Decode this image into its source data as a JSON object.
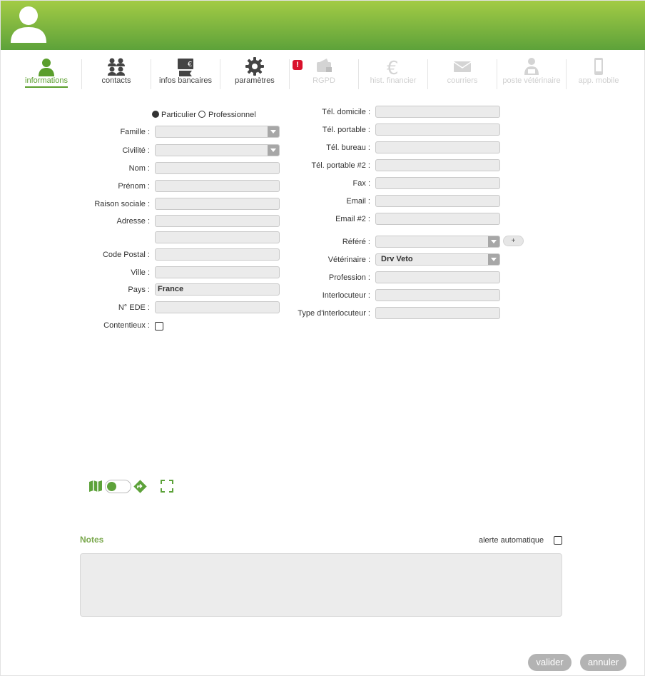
{
  "tabs": [
    {
      "label": "informations",
      "icon": "person-icon",
      "active": true
    },
    {
      "label": "contacts",
      "icon": "group-icon"
    },
    {
      "label": "infos bancaires",
      "icon": "bank-card-icon"
    },
    {
      "label": "paramètres",
      "icon": "gear-icon"
    },
    {
      "label": "RGPD",
      "icon": "wallet-lock-icon",
      "disabled": true
    },
    {
      "label": "hist. financier",
      "icon": "euro-icon",
      "disabled": true
    },
    {
      "label": "courriers",
      "icon": "envelope-icon",
      "disabled": true
    },
    {
      "label": "poste vétérinaire",
      "icon": "vet-person-icon",
      "disabled": true
    },
    {
      "label": "app. mobile",
      "icon": "mobile-icon",
      "disabled": true
    }
  ],
  "alert_badge": "!",
  "form_left": {
    "radio_particulier": "Particulier",
    "radio_professionnel": "Professionnel",
    "famille": {
      "label": "Famille :",
      "value": ""
    },
    "civilite": {
      "label": "Civilité :",
      "value": ""
    },
    "nom": {
      "label": "Nom :",
      "value": ""
    },
    "prenom": {
      "label": "Prénom :",
      "value": ""
    },
    "raison_sociale": {
      "label": "Raison sociale :",
      "value": ""
    },
    "adresse": {
      "label": "Adresse :",
      "value": "",
      "value2": ""
    },
    "code_postal": {
      "label": "Code Postal :",
      "value": ""
    },
    "ville": {
      "label": "Ville :",
      "value": ""
    },
    "pays": {
      "label": "Pays :",
      "value": "France"
    },
    "n_ede": {
      "label": "N° EDE :",
      "value": ""
    },
    "contentieux": {
      "label": "Contentieux :"
    }
  },
  "form_right": {
    "tel_domicile": {
      "label": "Tél. domicile :",
      "value": ""
    },
    "tel_portable": {
      "label": "Tél. portable :",
      "value": ""
    },
    "tel_bureau": {
      "label": "Tél. bureau :",
      "value": ""
    },
    "tel_portable2": {
      "label": "Tél. portable #2 :",
      "value": ""
    },
    "fax": {
      "label": "Fax :",
      "value": ""
    },
    "email": {
      "label": "Email :",
      "value": ""
    },
    "email2": {
      "label": "Email  #2 :",
      "value": ""
    },
    "refere": {
      "label": "Référé :",
      "value": ""
    },
    "refere_add": "+",
    "veterinaire": {
      "label": "Vétérinaire :",
      "value": "Drv Veto"
    },
    "profession": {
      "label": "Profession :",
      "value": ""
    },
    "interlocuteur": {
      "label": "Interlocuteur :",
      "value": ""
    },
    "type_interlocuteur": {
      "label": "Type d'interlocuteur :",
      "value": ""
    }
  },
  "map_tools": {
    "map_toggle_on": true
  },
  "notes": {
    "title": "Notes",
    "alert_label": "alerte automatique",
    "text": ""
  },
  "buttons": {
    "valider": "valider",
    "annuler": "annuler"
  },
  "colors": {
    "brand_green": "#5da23a",
    "header_light": "#a3cb45",
    "active_tab": "#5a9e2c",
    "alert": "#d9102b"
  }
}
